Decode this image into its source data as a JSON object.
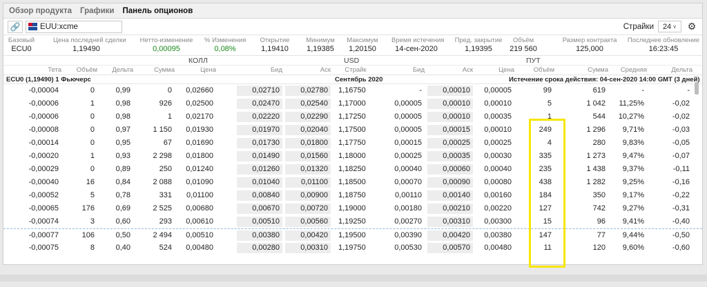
{
  "tabs": [
    "Обзор продукта",
    "Графики",
    "Панель опционов"
  ],
  "toolbar": {
    "symbol": "EUU:xcme",
    "strikes_label": "Страйки",
    "strikes_value": "24"
  },
  "summary": [
    {
      "label": "Базовый",
      "value": "ECU0"
    },
    {
      "label": "Цена последней сделки",
      "value": "1,19490"
    },
    {
      "label": "Нетто-изменение",
      "value": "0,00095",
      "color": "green"
    },
    {
      "label": "% Изменения",
      "value": "0,08%",
      "color": "green"
    },
    {
      "label": "Открытие",
      "value": "1,19410"
    },
    {
      "label": "Минимум",
      "value": "1,19385"
    },
    {
      "label": "Максимум",
      "value": "1,20150"
    },
    {
      "label": "Время истечения",
      "value": "14-сен-2020"
    },
    {
      "label": "Пред. закрытие",
      "value": "1,19395"
    },
    {
      "label": "Объём",
      "value": "219 560"
    },
    {
      "label": "Размер контракта",
      "value": "125,000"
    },
    {
      "label": "Последнее обновление",
      "value": "16:23:45"
    }
  ],
  "sections": {
    "call": "КОЛЛ",
    "currency": "USD",
    "put": "ПУТ"
  },
  "columns": [
    "Тета",
    "Объём",
    "Дельта",
    "Сумма",
    "Цена",
    "Бид",
    "Аск",
    "Страйк",
    "Бид",
    "Аск",
    "Цена",
    "Объём",
    "Сумма",
    "Средняя",
    "Дельта"
  ],
  "expiry": {
    "left": "ECU0 (1,19490) 1 Фьючерс",
    "center": "Сентябрь 2020",
    "right": "Истечение срока действия: 04-сен-2020 14:00 GMT (3 дней)"
  },
  "rows": [
    [
      "-0,00004",
      "0",
      "0,99",
      "0",
      "0,02660",
      "0,02710",
      "0,02780",
      "1,16750",
      "-",
      "0,00010",
      "0,00005",
      "99",
      "619",
      "-",
      "-"
    ],
    [
      "-0,00006",
      "1",
      "0,98",
      "926",
      "0,02500",
      "0,02470",
      "0,02540",
      "1,17000",
      "0,00005",
      "0,00010",
      "0,00010",
      "5",
      "1 042",
      "11,25%",
      "-0,02"
    ],
    [
      "-0,00006",
      "0",
      "0,98",
      "1",
      "0,02170",
      "0,02220",
      "0,02290",
      "1,17250",
      "0,00005",
      "0,00010",
      "0,00035",
      "1",
      "544",
      "10,27%",
      "-0,02"
    ],
    [
      "-0,00008",
      "0",
      "0,97",
      "1 150",
      "0,01930",
      "0,01970",
      "0,02040",
      "1,17500",
      "0,00005",
      "0,00015",
      "0,00010",
      "249",
      "1 296",
      "9,71%",
      "-0,03"
    ],
    [
      "-0,00014",
      "0",
      "0,95",
      "67",
      "0,01690",
      "0,01730",
      "0,01800",
      "1,17750",
      "0,00015",
      "0,00025",
      "0,00025",
      "4",
      "280",
      "9,83%",
      "-0,05"
    ],
    [
      "-0,00020",
      "1",
      "0,93",
      "2 298",
      "0,01800",
      "0,01490",
      "0,01560",
      "1,18000",
      "0,00025",
      "0,00035",
      "0,00030",
      "335",
      "1 273",
      "9,47%",
      "-0,07"
    ],
    [
      "-0,00029",
      "0",
      "0,89",
      "250",
      "0,01240",
      "0,01260",
      "0,01320",
      "1,18250",
      "0,00040",
      "0,00060",
      "0,00040",
      "235",
      "1 438",
      "9,37%",
      "-0,11"
    ],
    [
      "-0,00040",
      "16",
      "0,84",
      "2 088",
      "0,01090",
      "0,01040",
      "0,01100",
      "1,18500",
      "0,00070",
      "0,00090",
      "0,00080",
      "438",
      "1 282",
      "9,25%",
      "-0,16"
    ],
    [
      "-0,00052",
      "5",
      "0,78",
      "331",
      "0,01100",
      "0,00840",
      "0,00900",
      "1,18750",
      "0,00110",
      "0,00140",
      "0,00160",
      "184",
      "350",
      "9,17%",
      "-0,22"
    ],
    [
      "-0,00065",
      "176",
      "0,69",
      "2 525",
      "0,00680",
      "0,00670",
      "0,00720",
      "1,19000",
      "0,00180",
      "0,00210",
      "0,00220",
      "127",
      "742",
      "9,27%",
      "-0,31"
    ],
    [
      "-0,00074",
      "3",
      "0,60",
      "293",
      "0,00610",
      "0,00510",
      "0,00560",
      "1,19250",
      "0,00270",
      "0,00310",
      "0,00300",
      "15",
      "96",
      "9,41%",
      "-0,40"
    ],
    [
      "-0,00077",
      "106",
      "0,50",
      "2 494",
      "0,00510",
      "0,00380",
      "0,00420",
      "1,19500",
      "0,00390",
      "0,00420",
      "0,00380",
      "147",
      "77",
      "9,44%",
      "-0,50"
    ],
    [
      "-0,00075",
      "8",
      "0,40",
      "524",
      "0,00480",
      "0,00280",
      "0,00310",
      "1,19750",
      "0,00530",
      "0,00570",
      "0,00480",
      "11",
      "120",
      "9,60%",
      "-0,60"
    ]
  ]
}
